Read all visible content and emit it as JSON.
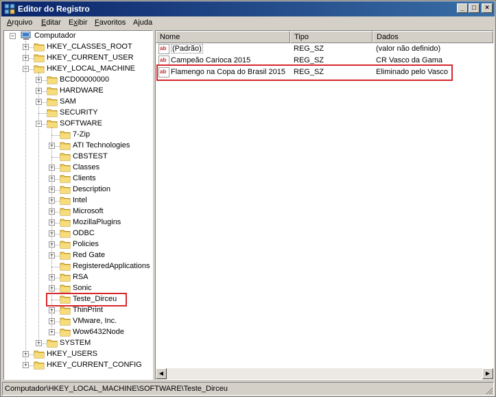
{
  "window": {
    "title": "Editor do Registro",
    "buttons": {
      "minimize": "_",
      "maximize": "□",
      "close": "×"
    }
  },
  "menu": [
    {
      "label": "Arquivo",
      "accel": "A",
      "rest": "rquivo"
    },
    {
      "label": "Editar",
      "accel": "E",
      "rest": "ditar"
    },
    {
      "label": "Exibir",
      "accel": "x",
      "pre": "E",
      "rest": "ibir"
    },
    {
      "label": "Favoritos",
      "accel": "F",
      "rest": "avoritos"
    },
    {
      "label": "Ajuda",
      "accel": "j",
      "pre": "A",
      "rest": "uda"
    }
  ],
  "tree": {
    "root": "Computador",
    "nodes": [
      {
        "label": "HKEY_CLASSES_ROOT",
        "level": 1,
        "expander": "+"
      },
      {
        "label": "HKEY_CURRENT_USER",
        "level": 1,
        "expander": "+"
      },
      {
        "label": "HKEY_LOCAL_MACHINE",
        "level": 1,
        "expander": "-"
      },
      {
        "label": "BCD00000000",
        "level": 2,
        "expander": "+"
      },
      {
        "label": "HARDWARE",
        "level": 2,
        "expander": "+"
      },
      {
        "label": "SAM",
        "level": 2,
        "expander": "+"
      },
      {
        "label": "SECURITY",
        "level": 2,
        "expander": ""
      },
      {
        "label": "SOFTWARE",
        "level": 2,
        "expander": "-"
      },
      {
        "label": "7-Zip",
        "level": 3,
        "expander": ""
      },
      {
        "label": "ATI Technologies",
        "level": 3,
        "expander": "+"
      },
      {
        "label": "CBSTEST",
        "level": 3,
        "expander": ""
      },
      {
        "label": "Classes",
        "level": 3,
        "expander": "+"
      },
      {
        "label": "Clients",
        "level": 3,
        "expander": "+"
      },
      {
        "label": "Description",
        "level": 3,
        "expander": "+"
      },
      {
        "label": "Intel",
        "level": 3,
        "expander": "+"
      },
      {
        "label": "Microsoft",
        "level": 3,
        "expander": "+"
      },
      {
        "label": "MozillaPlugins",
        "level": 3,
        "expander": "+"
      },
      {
        "label": "ODBC",
        "level": 3,
        "expander": "+"
      },
      {
        "label": "Policies",
        "level": 3,
        "expander": "+"
      },
      {
        "label": "Red Gate",
        "level": 3,
        "expander": "+"
      },
      {
        "label": "RegisteredApplications",
        "level": 3,
        "expander": ""
      },
      {
        "label": "RSA",
        "level": 3,
        "expander": "+"
      },
      {
        "label": "Sonic",
        "level": 3,
        "expander": "+"
      },
      {
        "label": "Teste_Dirceu",
        "level": 3,
        "expander": "",
        "selected": true
      },
      {
        "label": "ThinPrint",
        "level": 3,
        "expander": "+"
      },
      {
        "label": "VMware, Inc.",
        "level": 3,
        "expander": "+"
      },
      {
        "label": "Wow6432Node",
        "level": 3,
        "expander": "+"
      },
      {
        "label": "SYSTEM",
        "level": 2,
        "expander": "+"
      },
      {
        "label": "HKEY_USERS",
        "level": 1,
        "expander": "+"
      },
      {
        "label": "HKEY_CURRENT_CONFIG",
        "level": 1,
        "expander": "+"
      }
    ]
  },
  "list": {
    "columns": {
      "name": "Nome",
      "type": "Tipo",
      "data": "Dados"
    },
    "rows": [
      {
        "name": "(Padrão)",
        "type": "REG_SZ",
        "data": "(valor não definido)"
      },
      {
        "name": "Campeão Carioca 2015",
        "type": "REG_SZ",
        "data": "CR Vasco da Gama"
      },
      {
        "name": "Flamengo na Copa do Brasil 2015",
        "type": "REG_SZ",
        "data": "Eliminado pelo Vasco",
        "highlighted": true
      }
    ]
  },
  "status": "Computador\\HKEY_LOCAL_MACHINE\\SOFTWARE\\Teste_Dirceu",
  "colors": {
    "title_start": "#0a246a",
    "title_end": "#3a6ea5",
    "highlight": "#d8262a",
    "folder": "#f2cf5a"
  }
}
